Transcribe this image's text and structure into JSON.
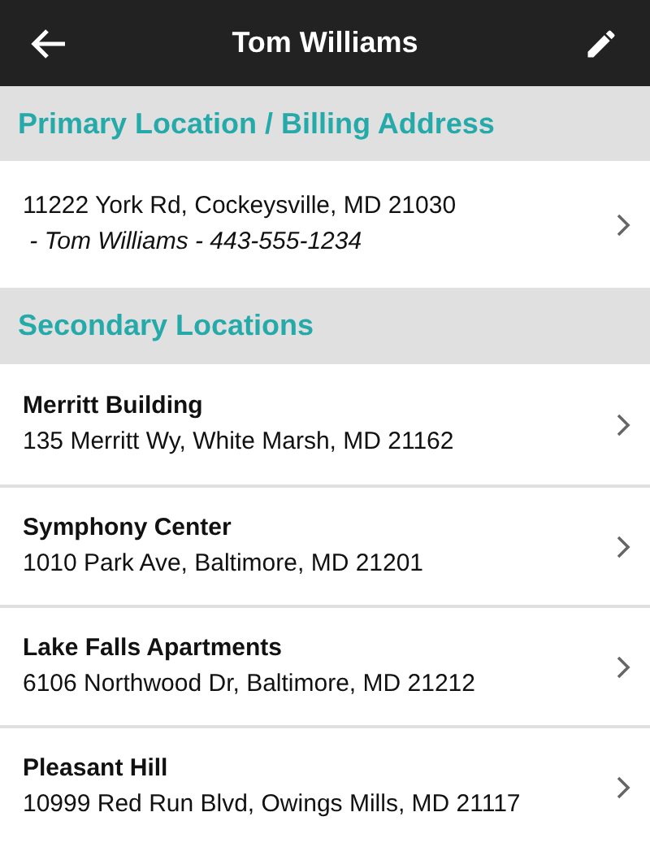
{
  "app_bar": {
    "title": "Tom Williams"
  },
  "primary": {
    "heading": "Primary Location / Billing Address",
    "address": "11222 York Rd, Cockeysville, MD 21030",
    "contact": " - Tom Williams - 443-555-1234"
  },
  "secondary": {
    "heading": "Secondary Locations",
    "items": [
      {
        "name": "Merritt Building",
        "address": "135 Merritt Wy, White Marsh, MD 21162"
      },
      {
        "name": "Symphony Center",
        "address": "1010 Park Ave, Baltimore, MD 21201"
      },
      {
        "name": "Lake Falls Apartments",
        "address": "6106 Northwood Dr, Baltimore, MD 21212"
      },
      {
        "name": "Pleasant Hill",
        "address": "10999 Red Run Blvd, Owings Mills, MD 21117"
      }
    ]
  }
}
